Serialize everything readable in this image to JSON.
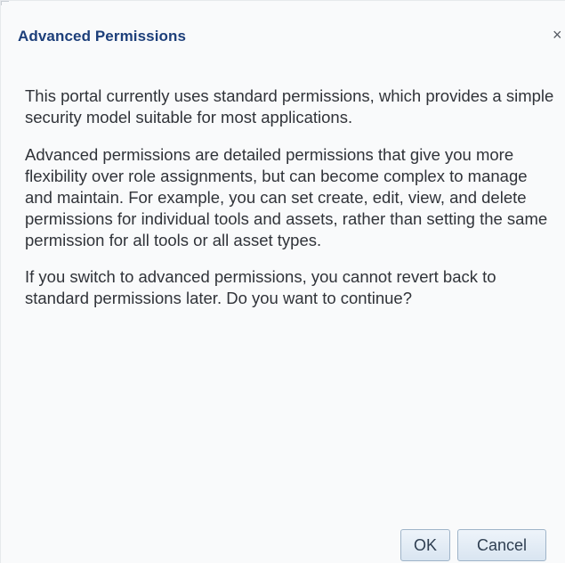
{
  "dialog": {
    "title": "Advanced Permissions",
    "close_glyph": "×",
    "close_icon": "close-icon",
    "paragraphs": [
      "This portal currently uses standard permissions, which provides a simple security model suitable for most applications.",
      "Advanced permissions are detailed permissions that give you more flexibility over role assignments, but can become complex to manage and maintain. For example, you can set create, edit, view, and delete permissions for individual tools and assets, rather than setting the same permission for all tools or all asset types.",
      "If you switch to advanced permissions, you cannot revert back to standard permissions later. Do you want to continue?"
    ],
    "buttons": {
      "ok_label": "OK",
      "cancel_label": "Cancel"
    }
  },
  "colors": {
    "title": "#1d3f7a",
    "text": "#303339",
    "background": "#f9fafb",
    "button_border": "#9fb4c9"
  }
}
